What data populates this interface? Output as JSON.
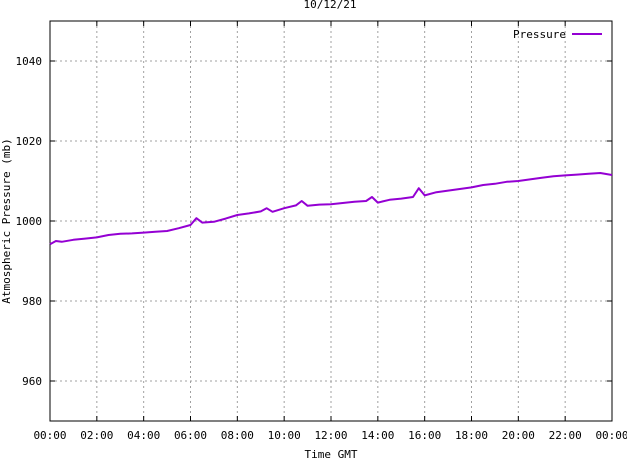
{
  "chart_data": {
    "type": "line",
    "title": "10/12/21",
    "xlabel": "Time GMT",
    "ylabel": "Atmospheric Pressure (mb)",
    "x_tick_labels": [
      "00:00",
      "02:00",
      "04:00",
      "06:00",
      "08:00",
      "10:00",
      "12:00",
      "14:00",
      "16:00",
      "18:00",
      "20:00",
      "22:00",
      "00:00"
    ],
    "x_range_hours": [
      0,
      24
    ],
    "y_ticks": [
      960,
      980,
      1000,
      1020,
      1040
    ],
    "y_tick_labels": [
      "960",
      "980",
      "1000",
      "1020",
      "1040"
    ],
    "ylim": [
      950,
      1050
    ],
    "grid": true,
    "legend_position": "top-right",
    "series": [
      {
        "name": "Pressure",
        "color": "#9400d3",
        "x_hours": [
          0,
          0.25,
          0.5,
          1,
          1.5,
          2,
          2.5,
          3,
          3.5,
          4,
          4.5,
          5,
          5.5,
          6,
          6.25,
          6.5,
          7,
          7.5,
          8,
          8.5,
          9,
          9.25,
          9.5,
          10,
          10.5,
          10.75,
          11,
          11.5,
          12,
          12.5,
          13,
          13.5,
          13.75,
          14,
          14.5,
          15,
          15.5,
          15.75,
          16,
          16.5,
          17,
          17.5,
          18,
          18.5,
          19,
          19.5,
          20,
          20.5,
          21,
          21.5,
          22,
          22.5,
          23,
          23.5,
          24
        ],
        "values": [
          994.2,
          995,
          994.8,
          995.3,
          995.6,
          995.9,
          996.5,
          996.8,
          996.9,
          997.1,
          997.3,
          997.5,
          998.2,
          999.0,
          1000.7,
          999.6,
          999.8,
          1000.6,
          1001.5,
          1001.9,
          1002.4,
          1003.2,
          1002.3,
          1003.2,
          1003.9,
          1005.0,
          1003.8,
          1004.1,
          1004.2,
          1004.5,
          1004.8,
          1005.0,
          1006.0,
          1004.6,
          1005.3,
          1005.6,
          1006.0,
          1008.2,
          1006.4,
          1007.2,
          1007.6,
          1008.0,
          1008.4,
          1009.0,
          1009.3,
          1009.8,
          1010.0,
          1010.4,
          1010.8,
          1011.2,
          1011.4,
          1011.6,
          1011.8,
          1012.0,
          1011.5
        ]
      }
    ]
  }
}
